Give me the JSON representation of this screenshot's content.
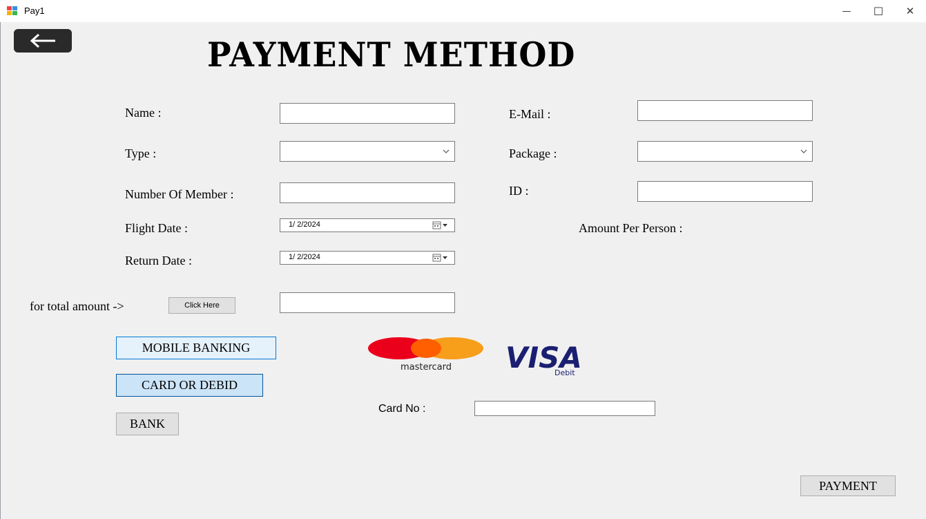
{
  "window": {
    "title": "Pay1",
    "minimize": "—",
    "maximize": "☐",
    "close": "✕"
  },
  "page": {
    "title": "PAYMENT METHOD"
  },
  "form": {
    "name_label": "Name :",
    "name_value": "",
    "email_label": "E-Mail :",
    "email_value": "",
    "type_label": "Type :",
    "type_value": "",
    "package_label": "Package :",
    "package_value": "",
    "members_label": "Number Of Member :",
    "members_value": "",
    "id_label": "ID :",
    "id_value": "",
    "flight_date_label": "Flight Date :",
    "flight_date_value": "1/  2/2024",
    "return_date_label": "Return Date :",
    "return_date_value": "1/  2/2024",
    "amount_per_person_label": "Amount Per Person :",
    "total_label": "for total amount ->",
    "click_here_label": "Click Here",
    "total_value": ""
  },
  "methods": {
    "mobile_banking": "MOBILE BANKING",
    "card_or_debit": "CARD OR DEBID",
    "bank": "BANK"
  },
  "card": {
    "card_no_label": "Card No :",
    "card_no_value": "",
    "mastercard_text": "mastercard",
    "visa_text": "VISA",
    "visa_sub": "Debit"
  },
  "actions": {
    "payment_label": "PAYMENT"
  },
  "icons": {
    "back": "arrow-left-icon",
    "dropdown": "chevron-down-icon",
    "calendar": "calendar-icon"
  },
  "colors": {
    "mastercard_red": "#eb001b",
    "mastercard_orange": "#f79e1b",
    "visa_blue": "#1a1f71"
  }
}
